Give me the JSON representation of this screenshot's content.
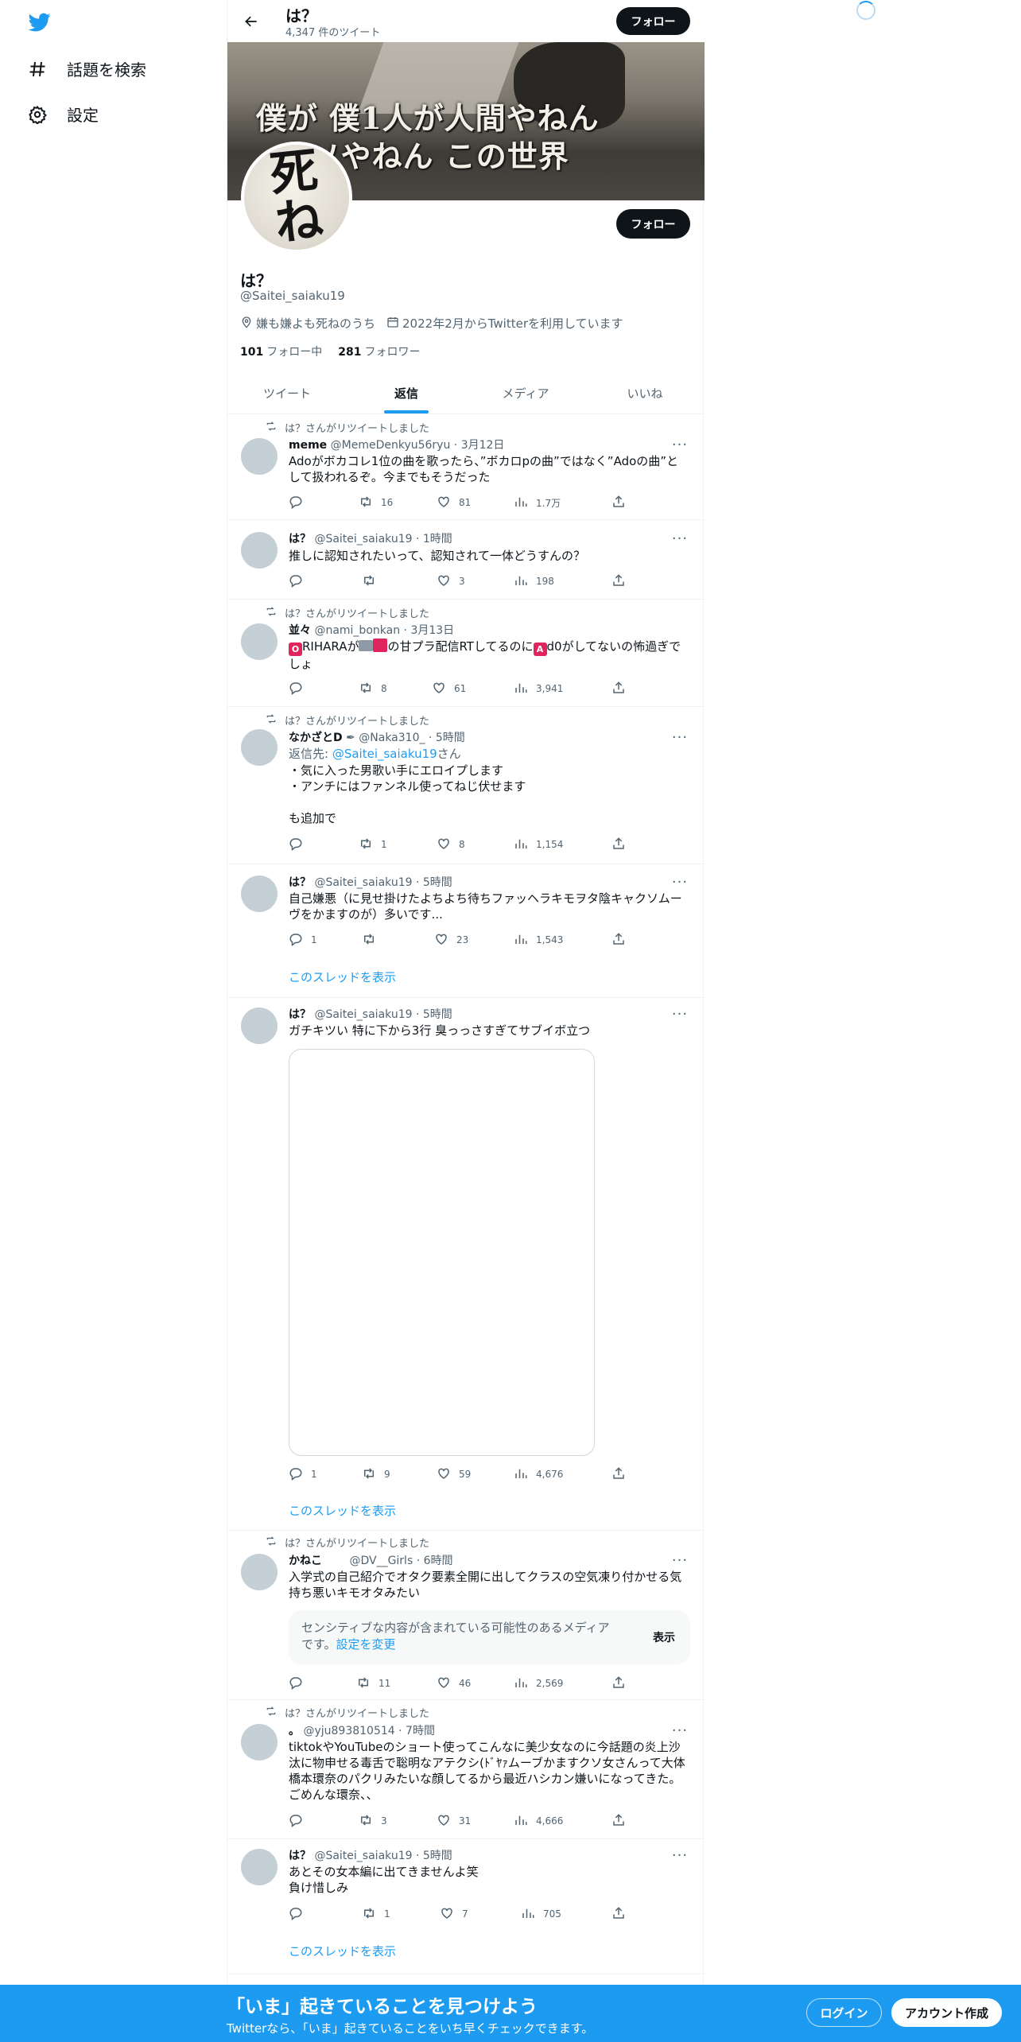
{
  "nav": {
    "explore_label": "話題を検索",
    "settings_label": "設定"
  },
  "header": {
    "name": "は？",
    "tweet_count": "4,347 件のツイート",
    "follow_label": "フォロー"
  },
  "banner": {
    "caption": "僕が 僕1人が人間やねん\n  ウソやねん この世界"
  },
  "avatar_text": "死ね",
  "profile": {
    "follow_label": "フォロー",
    "name": "は？",
    "handle": "@Saitei_saiaku19",
    "location": "嫌も嫌よも死ねのうち",
    "joined": "2022年2月からTwitterを利用しています",
    "following_count": "101",
    "following_label": "フォロー中",
    "followers_count": "281",
    "followers_label": "フォロワー"
  },
  "tabs": [
    "ツイート",
    "返信",
    "メディア",
    "いいね"
  ],
  "active_tab": "返信",
  "tweets": [
    {
      "retweet_by": "は？さんがリツイートしました",
      "name": "meme",
      "handle": "@MemeDenkyu56ryu",
      "time": "3月12日",
      "text": "Adoがボカコレ1位の曲を歌ったら、”ボカロpの曲”ではなく”Adoの曲”として扱われるぞ。今までもそうだった",
      "replies": "",
      "retweets": "16",
      "likes": "81",
      "views": "1.7万"
    },
    {
      "name": "は？",
      "handle": "@Saitei_saiaku19",
      "time": "1時間",
      "text": "推しに認知されたいって、認知されて一体どうすんの？",
      "replies": "",
      "retweets": "",
      "likes": "3",
      "views": "198"
    },
    {
      "retweet_by": "は？さんがリツイートしました",
      "name": "並々",
      "handle": "@nami_bonkan",
      "time": "3月13日",
      "text_emoji_o": "O",
      "text_part1": "RIHARAが",
      "text_part2": "の甘プラ配信RTしてるのに",
      "text_emoji_a": "A",
      "text_part3": "d0がしてないの怖過ぎでしょ",
      "replies": "",
      "retweets": "8",
      "likes": "61",
      "views": "3,941"
    },
    {
      "retweet_by": "は？さんがリツイートしました",
      "name": "なかざとD",
      "handle": "@Naka310_",
      "time": "5時間",
      "reply_to_prefix": "返信先: ",
      "reply_to_handle": "@Saitei_saiaku19",
      "reply_to_suffix": "さん",
      "text": "・気に入った男歌い手にエロイプします\n・アンチにはファンネル使ってねじ伏せます\n\nも追加で",
      "replies": "",
      "retweets": "1",
      "likes": "8",
      "views": "1,154"
    },
    {
      "name": "は？",
      "handle": "@Saitei_saiaku19",
      "time": "5時間",
      "text": "自己嫌悪（に見せ掛けたよちよち待ちファッヘラキモヲタ陰キャクソムーヴをかますのが）多いです...",
      "replies": "1",
      "retweets": "",
      "likes": "23",
      "views": "1,543",
      "thread": "このスレッドを表示"
    },
    {
      "name": "は？",
      "handle": "@Saitei_saiaku19",
      "time": "5時間",
      "text": "ガチキツい 特に下から3行 臭っっさすぎてサブイボ立つ",
      "replies": "1",
      "retweets": "9",
      "likes": "59",
      "views": "4,676",
      "thread": "このスレッドを表示"
    },
    {
      "retweet_by": "は？さんがリツイートしました",
      "name": "かねこ",
      "handle": "@DV__Girls",
      "time": "6時間",
      "text": "入学式の自己紹介でオタク要素全開に出してクラスの空気凍り付かせる気持ち悪いキモオタみたい",
      "sensitive_text": "センシティブな内容が含まれている可能性のあるメディアです。",
      "sensitive_link": "設定を変更",
      "sensitive_button": "表示",
      "replies": "",
      "retweets": "11",
      "likes": "46",
      "views": "2,569"
    },
    {
      "retweet_by": "は？さんがリツイートしました",
      "name": "。",
      "handle": "@yju893810514",
      "time": "7時間",
      "text": "tiktokやYouTubeのショート使ってこんなに美少女なのに今話題の炎上沙汰に物申せる毒舌で聡明なアテクシ(ﾄﾞﾔｧムーブかますクソ女さんって大体橋本環奈のパクリみたいな顔してるから最近ハシカン嫌いになってきた。ごめんな環奈、、",
      "replies": "",
      "retweets": "3",
      "likes": "31",
      "views": "4,666"
    },
    {
      "name": "は？",
      "handle": "@Saitei_saiaku19",
      "time": "5時間",
      "text": "あとその女本編に出てきませんよ笑\n負け惜しみ",
      "replies": "",
      "retweets": "1",
      "likes": "7",
      "views": "705",
      "thread": "このスレッドを表示"
    }
  ],
  "bottom_bar": {
    "title": "「いま」起きていることを見つけよう",
    "subtitle": "Twitterなら、「いま」起きていることをいち早くチェックできます。",
    "login": "ログイン",
    "signup": "アカウント作成"
  },
  "colors": {
    "accent": "#1d9bf0",
    "text": "#0f1419",
    "secondary": "#536471"
  }
}
